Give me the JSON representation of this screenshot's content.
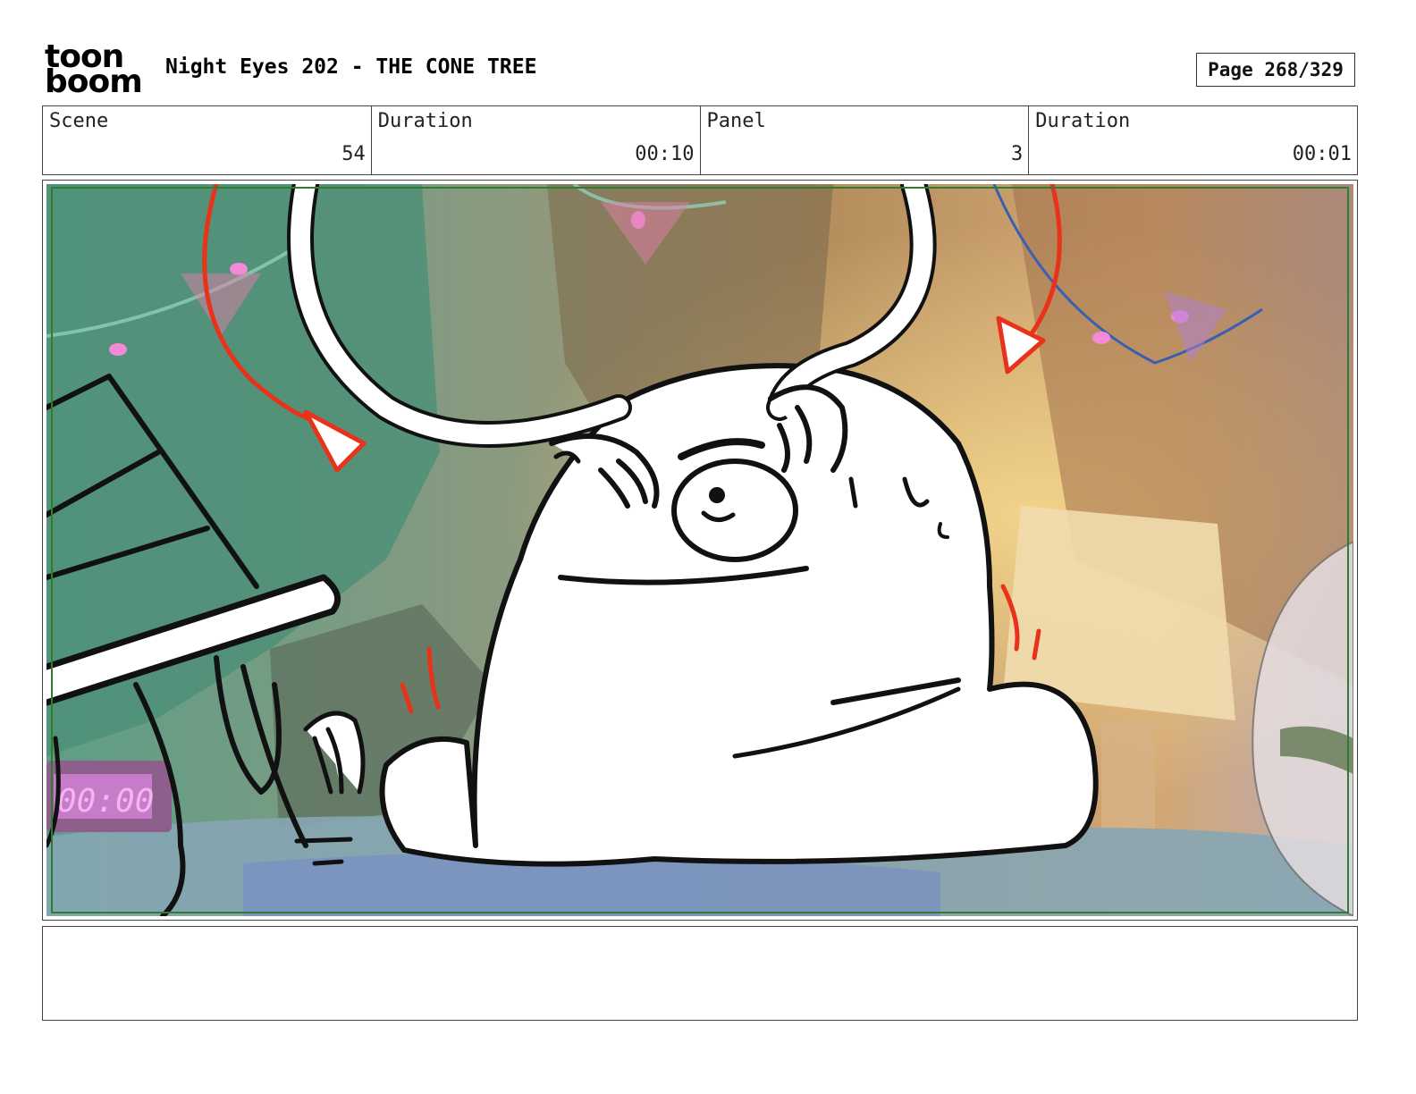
{
  "header": {
    "logo_line1": "toon",
    "logo_line2": "boom",
    "title": "Night Eyes 202 - THE CONE TREE",
    "page": "Page 268/329"
  },
  "info": {
    "scene_label": "Scene",
    "scene_value": "54",
    "scene_duration_label": "Duration",
    "scene_duration_value": "00:10",
    "panel_label": "Panel",
    "panel_value": "3",
    "panel_duration_label": "Duration",
    "panel_duration_value": "00:01"
  },
  "panel": {
    "clock_text": "00:00",
    "colors": {
      "safe_frame": "#2e7d32",
      "action_arrow": "#e8321a",
      "line_art": "#111111"
    }
  },
  "notes": {
    "text": ""
  }
}
